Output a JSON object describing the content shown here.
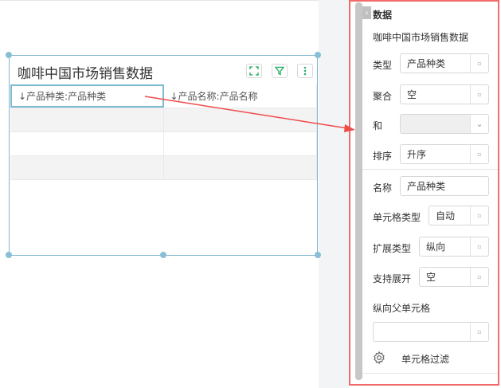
{
  "widget": {
    "title": "咖啡中国市场销售数据",
    "columns": [
      "↓产品种类:产品种类",
      "↓产品名称:产品名称"
    ]
  },
  "panel": {
    "heading": "数据",
    "dataset": "咖啡中国市场销售数据",
    "fields": {
      "type_label": "类型",
      "type_value": "产品种类",
      "aggregate_label": "聚合",
      "aggregate_value": "空",
      "sum_label": "和",
      "sum_value": "",
      "sort_label": "排序",
      "sort_value": "升序",
      "name_label": "名称",
      "name_value": "产品种类",
      "cell_type_label": "单元格类型",
      "cell_type_value": "自动",
      "expand_type_label": "扩展类型",
      "expand_type_value": "纵向",
      "support_expand_label": "支持展开",
      "support_expand_value": "空",
      "parent_cell_label": "纵向父单元格",
      "parent_cell_value": ""
    },
    "cell_filter_label": "单元格过滤"
  },
  "colors": {
    "accent_border": "#f16b6b",
    "selection": "#7fb8d1",
    "tool_green": "#2fb36b"
  }
}
